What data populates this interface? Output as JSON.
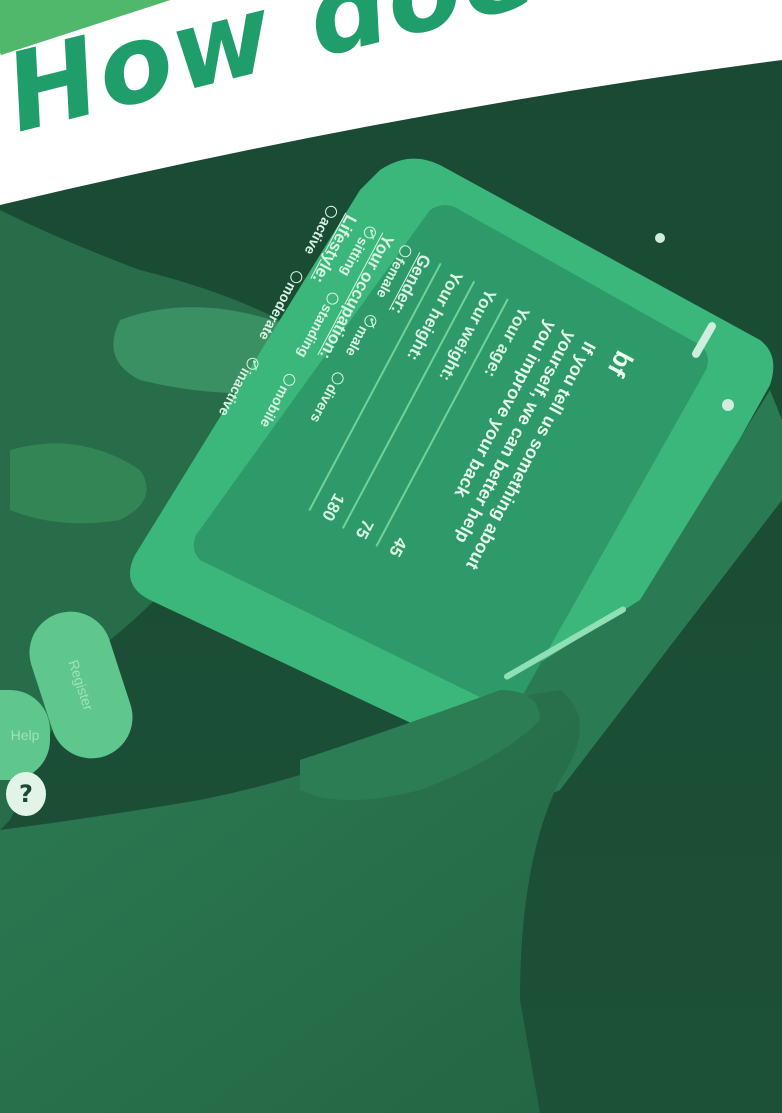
{
  "headline": "How does i",
  "phone": {
    "logo_text": "bf",
    "intro": "If you tell us something about yourself, we can better help you improve your back",
    "fields": [
      {
        "label": "Your age:",
        "value": "45"
      },
      {
        "label": "Your weight:",
        "value": "75"
      },
      {
        "label": "Your height:",
        "value": "180"
      }
    ],
    "gender": {
      "label": "Gender:",
      "options": [
        {
          "label": "female",
          "checked": false
        },
        {
          "label": "male",
          "checked": true
        },
        {
          "label": "divers",
          "checked": false
        }
      ]
    },
    "occupation": {
      "label": "Your occupation:",
      "options": [
        {
          "label": "sitting",
          "checked": true
        },
        {
          "label": "standing",
          "checked": false
        },
        {
          "label": "mobile",
          "checked": false
        }
      ]
    },
    "lifestyle": {
      "label": "Lifestyle:",
      "options": [
        {
          "label": "active",
          "checked": false
        },
        {
          "label": "moderate",
          "checked": false
        },
        {
          "label": "inactive",
          "checked": true
        }
      ]
    },
    "register_label": "Register",
    "help_label": "Help",
    "question_label": "?"
  },
  "colors": {
    "background": "#1d4a34",
    "headline": "#1f9e6b",
    "accent": "#4fb86a",
    "screen_text": "#d9f3e2"
  }
}
